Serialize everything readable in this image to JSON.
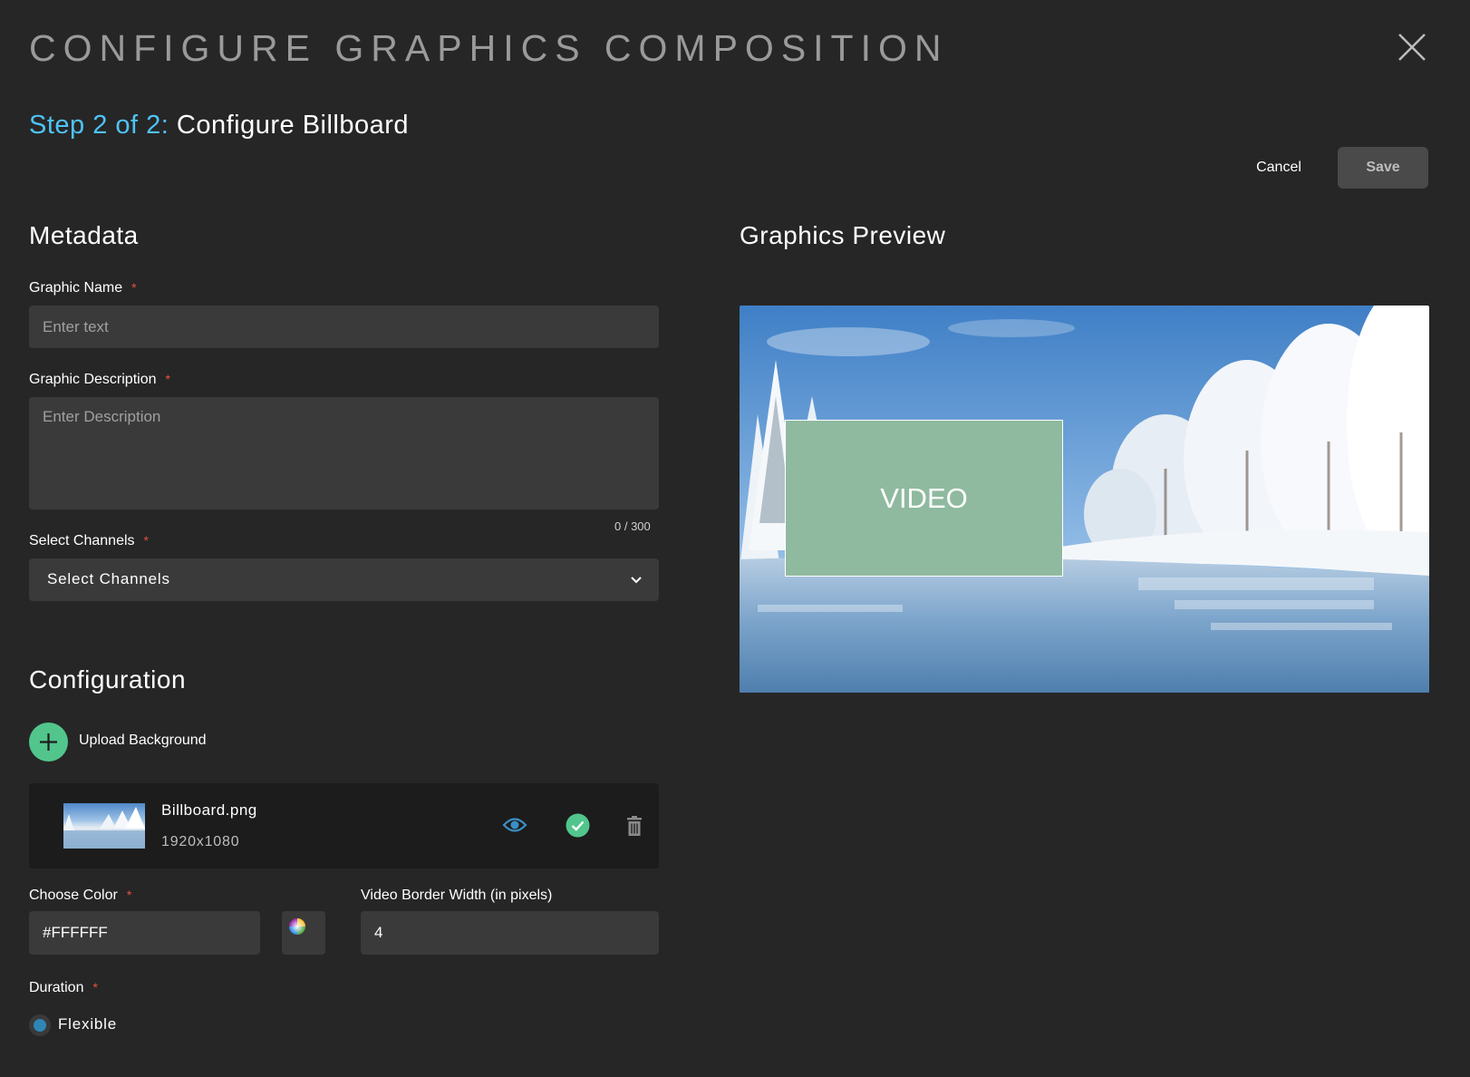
{
  "dialog": {
    "title": "CONFIGURE GRAPHICS COMPOSITION",
    "close_icon": "close-icon"
  },
  "step": {
    "prefix": "Step 2 of 2:",
    "name": "Configure Billboard"
  },
  "actions": {
    "cancel_label": "Cancel",
    "save_label": "Save"
  },
  "metadata": {
    "heading": "Metadata",
    "graphic_name": {
      "label": "Graphic Name",
      "required_mark": "*",
      "value": "",
      "placeholder": "Enter text"
    },
    "graphic_description": {
      "label": "Graphic Description",
      "required_mark": "*",
      "value": "",
      "placeholder": "Enter Description",
      "counter": "0 / 300"
    },
    "channels": {
      "label": "Select Channels",
      "required_mark": "*",
      "selected": "Select Channels",
      "icon": "chevron-down-icon"
    }
  },
  "configuration": {
    "heading": "Configuration",
    "upload": {
      "label": "Upload Background",
      "icon": "plus-icon",
      "color": "#52c58c"
    },
    "background_file": {
      "name": "Billboard.png",
      "dimensions": "1920x1080",
      "icons": [
        "eye-icon",
        "check-circle-icon",
        "trash-icon"
      ]
    },
    "color": {
      "label": "Choose Color",
      "required_mark": "*",
      "value": "#FFFFFF",
      "picker_icon": "color-wheel-icon"
    },
    "border_width": {
      "label": "Video Border Width (in pixels)",
      "value": "4"
    },
    "duration": {
      "label": "Duration",
      "required_mark": "*",
      "option": "Flexible",
      "selected": true
    }
  },
  "preview": {
    "heading": "Graphics Preview",
    "video_label": "VIDEO",
    "video_color": "#8fba9f"
  },
  "colors": {
    "background": "#262626",
    "accent_blue": "#4fc3f7",
    "required_red": "#e5533d",
    "success_green": "#52c58c"
  }
}
